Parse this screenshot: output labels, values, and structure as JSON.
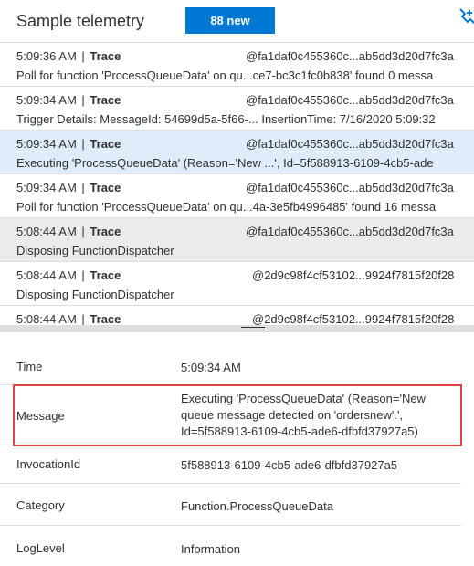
{
  "header": {
    "title": "Sample telemetry",
    "new_badge": "88 new",
    "pin_icon": "pin-plus-icon"
  },
  "telemetry_rows": [
    {
      "time": "5:09:36 AM",
      "sep": "|",
      "type": "Trace",
      "op_id": "@fa1daf0c455360c...ab5dd3d20d7fc3a",
      "message": "Poll for function 'ProcessQueueData' on qu...ce7-bc3c1fc0b838' found 0 messa"
    },
    {
      "time": "5:09:34 AM",
      "sep": "|",
      "type": "Trace",
      "op_id": "@fa1daf0c455360c...ab5dd3d20d7fc3a",
      "message": "Trigger Details: MessageId: 54699d5a-5f66-...  InsertionTime: 7/16/2020 5:09:32"
    },
    {
      "time": "5:09:34 AM",
      "sep": "|",
      "type": "Trace",
      "op_id": "@fa1daf0c455360c...ab5dd3d20d7fc3a",
      "message": "Executing 'ProcessQueueData' (Reason='New ...', Id=5f588913-6109-4cb5-ade"
    },
    {
      "time": "5:09:34 AM",
      "sep": "|",
      "type": "Trace",
      "op_id": "@fa1daf0c455360c...ab5dd3d20d7fc3a",
      "message": "Poll for function 'ProcessQueueData' on qu...4a-3e5fb4996485' found 16 messa"
    },
    {
      "time": "5:08:44 AM",
      "sep": "|",
      "type": "Trace",
      "op_id": "@fa1daf0c455360c...ab5dd3d20d7fc3a",
      "message": "Disposing FunctionDispatcher"
    },
    {
      "time": "5:08:44 AM",
      "sep": "|",
      "type": "Trace",
      "op_id": "@2d9c98f4cf53102...9924f7815f20f28",
      "message": "Disposing FunctionDispatcher"
    },
    {
      "time": "5:08:44 AM",
      "sep": "|",
      "type": "Trace",
      "op_id": "@2d9c98f4cf53102...9924f7815f20f28",
      "message": ""
    }
  ],
  "details": {
    "time_label": "Time",
    "time_value": "5:09:34 AM",
    "message_label": "Message",
    "message_value": "Executing 'ProcessQueueData' (Reason='New queue message detected on 'ordersnew'.', Id=5f588913-6109-4cb5-ade6-dfbfd37927a5)",
    "invocation_label": "InvocationId",
    "invocation_value": "5f588913-6109-4cb5-ade6-dfbfd37927a5",
    "category_label": "Category",
    "category_value": "Function.ProcessQueueData",
    "loglevel_label": "LogLevel",
    "loglevel_value": "Information"
  },
  "colors": {
    "accent": "#0078d4",
    "selected_row": "#deecf9",
    "hover_row": "#edebe9",
    "highlight_border": "#e04343"
  }
}
